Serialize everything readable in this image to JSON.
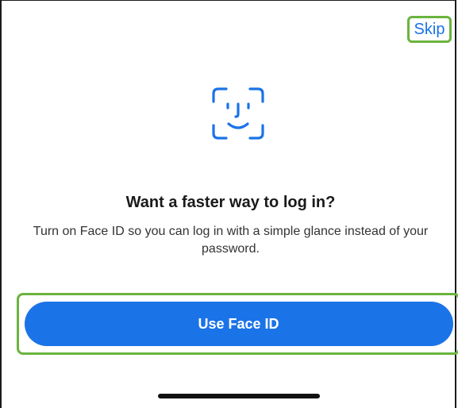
{
  "header": {
    "skip_label": "Skip"
  },
  "content": {
    "icon": "face-id-icon",
    "title": "Want a faster way to log in?",
    "description": "Turn on Face ID so you can log in with a simple glance instead of your password."
  },
  "actions": {
    "primary_label": "Use Face ID"
  },
  "colors": {
    "accent": "#1b73e8",
    "highlight": "#6ab43e",
    "text": "#1a1a1a"
  }
}
